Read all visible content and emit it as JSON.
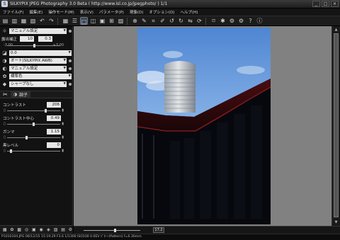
{
  "window": {
    "title": "SILKYPIX JPEG Photography 3.0 Beta ( http://www.isl.co.jp/jpegphoto/ ) 1/1",
    "minimize": "_",
    "maximize": "□",
    "close": "×"
  },
  "menu": [
    "ファイル(F)",
    "編集(E)",
    "操作モード(M)",
    "表示(V)",
    "パラメータ(P)",
    "現像(D)",
    "オプション(O)",
    "ヘルプ(H)"
  ],
  "sidebar": {
    "white_balance_preset": "マニュアル設定",
    "exposure": {
      "label": "露出補正",
      "value1": "10",
      "value2": "0.3",
      "min": "-3.00",
      "max": "+3.00"
    },
    "wb_value": "0.0",
    "wb_mode": "オート(SILKYPIX AWB)",
    "sharpness_preset": "マニュアル設定",
    "color_preset": "標準色",
    "sharp_mode": "シャープなし",
    "tabs": {
      "tone": "調子"
    },
    "params": [
      {
        "label": "コントラスト",
        "value": "206",
        "level": 0.72
      },
      {
        "label": "コントラスト中心",
        "value": "0.49",
        "level": 0.49
      },
      {
        "label": "ガンマ",
        "value": "1.15",
        "level": 0.36
      },
      {
        "label": "黒レベル",
        "value": "0",
        "level": 0.05
      }
    ]
  },
  "viewer": {
    "zoom_value": "17.2",
    "zoom_level": 0.55
  },
  "status_text": "P1010104.JPG 06/12/15 15:19:29 F3.6 1/1300 ISO100 0.0EV ﾊﾟﾀｰﾝ(Pattern) f=6.30mm",
  "colors": {
    "accent": "#3a4a5a",
    "sky_top": "#5a8fd6",
    "sky_bottom": "#bcd6f2"
  }
}
